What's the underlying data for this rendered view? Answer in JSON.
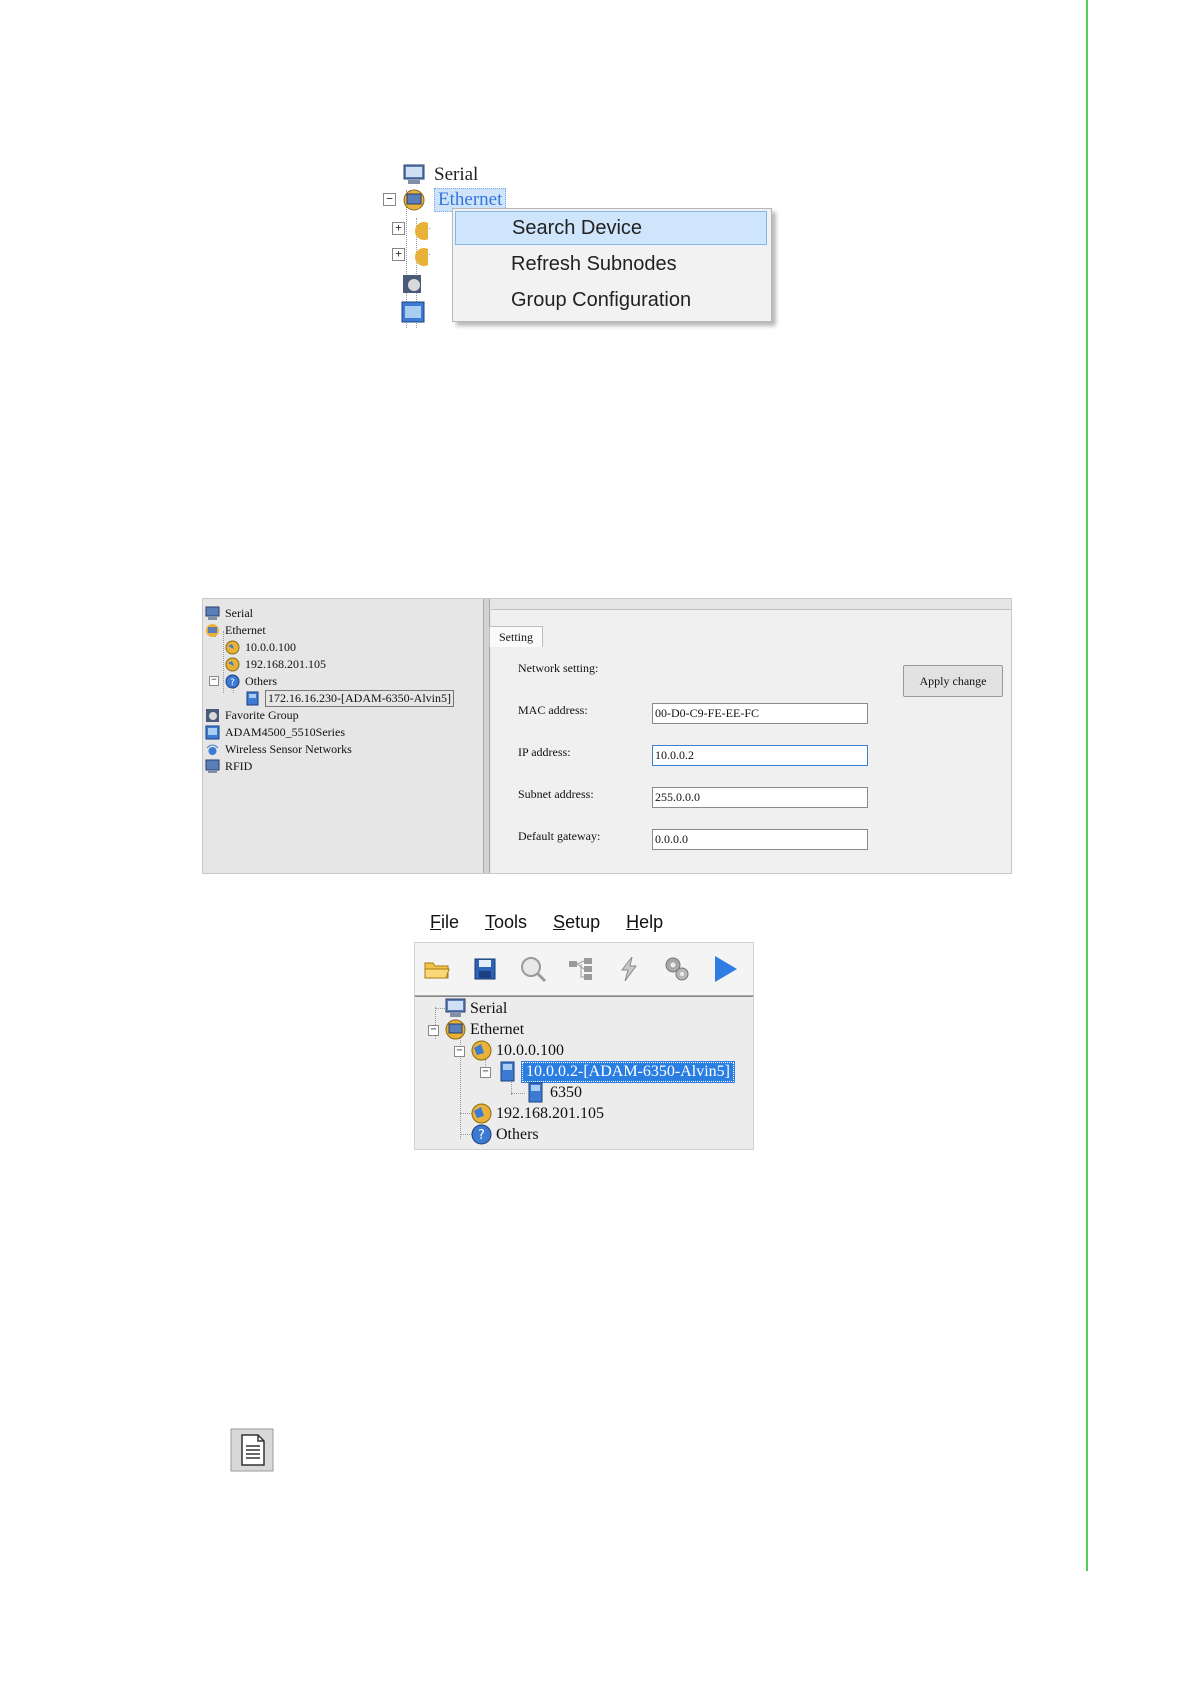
{
  "context_tree": {
    "items": [
      {
        "label": "Serial"
      },
      {
        "label": "Ethernet"
      }
    ]
  },
  "context_menu": {
    "items": [
      {
        "label": "Search Device",
        "highlighted": true
      },
      {
        "label": "Refresh Subnodes",
        "highlighted": false
      },
      {
        "label": "Group Configuration",
        "highlighted": false
      }
    ]
  },
  "network_tree": {
    "items": [
      {
        "label": "Serial"
      },
      {
        "label": "Ethernet"
      },
      {
        "label": "10.0.0.100"
      },
      {
        "label": "192.168.201.105"
      },
      {
        "label": "Others"
      },
      {
        "label": "172.16.16.230-[ADAM-6350-Alvin5]"
      },
      {
        "label": "Favorite Group"
      },
      {
        "label": "ADAM4500_5510Series"
      },
      {
        "label": "Wireless Sensor Networks"
      },
      {
        "label": "RFID"
      }
    ]
  },
  "settings": {
    "tab_label": "Setting",
    "section_title": "Network setting:",
    "apply_button": "Apply change",
    "fields": [
      {
        "label": "MAC address:",
        "value": "00-D0-C9-FE-EE-FC"
      },
      {
        "label": "IP address:",
        "value": "10.0.0.2"
      },
      {
        "label": "Subnet address:",
        "value": "255.0.0.0"
      },
      {
        "label": "Default gateway:",
        "value": "0.0.0.0"
      }
    ]
  },
  "menu_bar": {
    "items": [
      {
        "accel": "F",
        "rest": "ile"
      },
      {
        "accel": "T",
        "rest": "ools"
      },
      {
        "accel": "S",
        "rest": "etup"
      },
      {
        "accel": "H",
        "rest": "elp"
      }
    ]
  },
  "toolbar_icons": [
    "open-folder-icon",
    "save-icon",
    "search-icon",
    "network-icon",
    "flash-icon",
    "gears-icon",
    "play-icon"
  ],
  "device_tree": {
    "items": [
      {
        "label": "Serial"
      },
      {
        "label": "Ethernet"
      },
      {
        "label": "10.0.0.100"
      },
      {
        "label": "10.0.0.2-[ADAM-6350-Alvin5]"
      },
      {
        "label": "6350"
      },
      {
        "label": "192.168.201.105"
      },
      {
        "label": "Others"
      }
    ]
  },
  "colors": {
    "page_rule": "#55cc55",
    "selection": "#2a7de1",
    "menu_highlight": "#cfe5fb"
  }
}
